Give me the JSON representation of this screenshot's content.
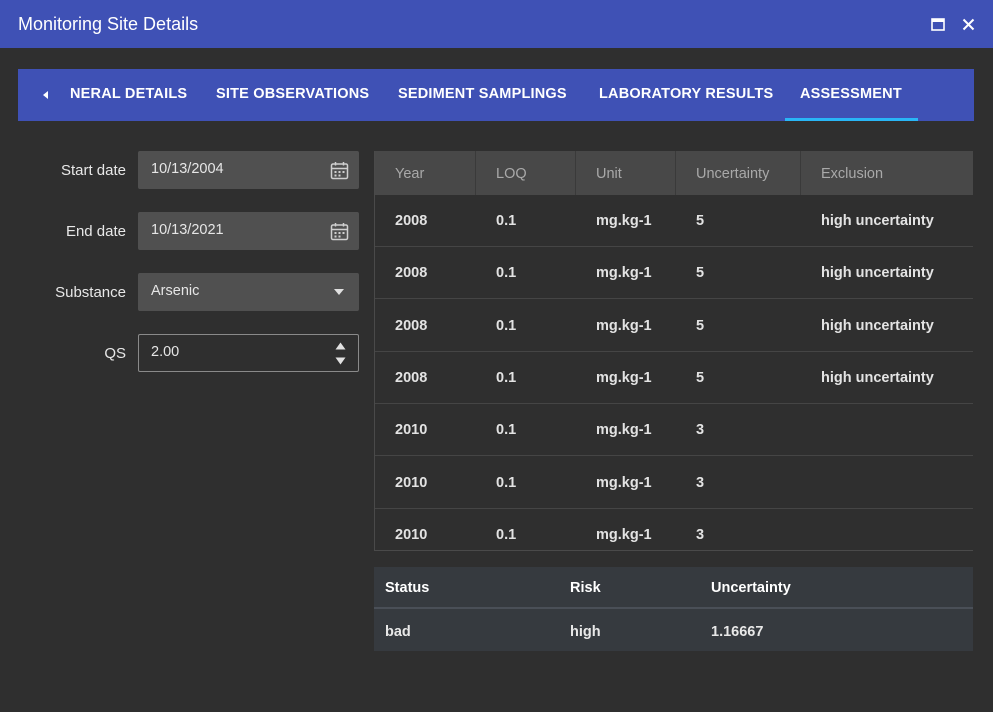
{
  "window": {
    "title": "Monitoring Site Details"
  },
  "tabs": [
    {
      "label": "NERAL DETAILS"
    },
    {
      "label": "SITE OBSERVATIONS"
    },
    {
      "label": "SEDIMENT SAMPLINGS"
    },
    {
      "label": "LABORATORY RESULTS"
    },
    {
      "label": "ASSESSMENT",
      "active": true
    }
  ],
  "form": {
    "start_date": {
      "label": "Start date",
      "value": "10/13/2004"
    },
    "end_date": {
      "label": "End date",
      "value": "10/13/2021"
    },
    "substance": {
      "label": "Substance",
      "value": "Arsenic"
    },
    "qs": {
      "label": "QS",
      "value": "2.00"
    }
  },
  "grid": {
    "columns": [
      "Year",
      "LOQ",
      "Unit",
      "Uncertainty",
      "Exclusion"
    ],
    "rows": [
      [
        "2008",
        "0.1",
        "mg.kg-1",
        "5",
        "high uncertainty"
      ],
      [
        "2008",
        "0.1",
        "mg.kg-1",
        "5",
        "high uncertainty"
      ],
      [
        "2008",
        "0.1",
        "mg.kg-1",
        "5",
        "high uncertainty"
      ],
      [
        "2008",
        "0.1",
        "mg.kg-1",
        "5",
        "high uncertainty"
      ],
      [
        "2010",
        "0.1",
        "mg.kg-1",
        "3",
        ""
      ],
      [
        "2010",
        "0.1",
        "mg.kg-1",
        "3",
        ""
      ],
      [
        "2010",
        "0.1",
        "mg.kg-1",
        "3",
        ""
      ]
    ]
  },
  "summary": {
    "columns": [
      "Status",
      "Risk",
      "Uncertainty"
    ],
    "values": [
      "bad",
      "high",
      "1.16667"
    ]
  },
  "icons": {
    "tab_scroll_left": "triangle-left-icon",
    "maximize": "maximize-icon",
    "close": "close-icon",
    "calendar": "calendar-icon",
    "dropdown": "chevron-down-icon",
    "stepper_up": "triangle-up-icon",
    "stepper_down": "triangle-down-icon"
  },
  "colors": {
    "accent": "#3f51b5",
    "tab_indicator": "#29b6f6",
    "background": "#2f2f2f"
  }
}
